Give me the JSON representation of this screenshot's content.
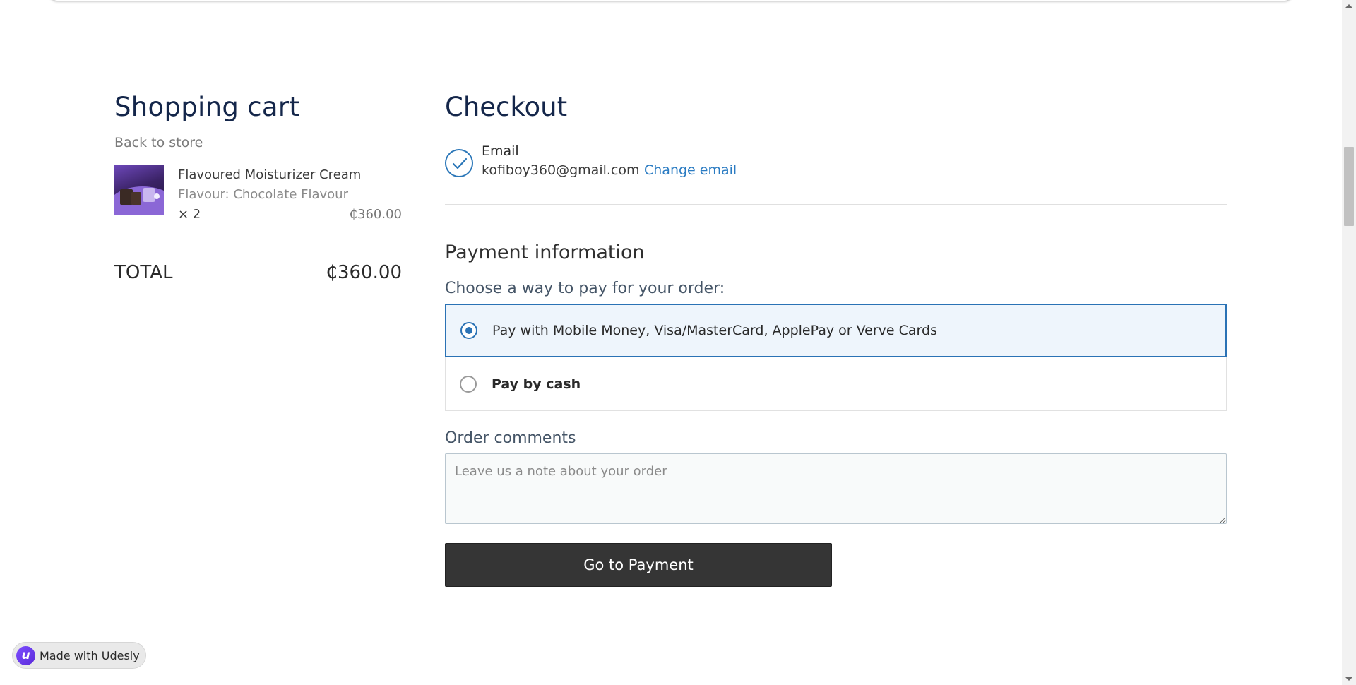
{
  "cart": {
    "title": "Shopping cart",
    "back_link": "Back to store",
    "items": [
      {
        "name": "Flavoured Moisturizer Cream",
        "variant": "Flavour: Chocolate Flavour",
        "quantity": "× 2",
        "price": "₵360.00",
        "image_icon": "product-photo-icon"
      }
    ],
    "total_label": "TOTAL",
    "total_value": "₵360.00"
  },
  "checkout": {
    "title": "Checkout",
    "email": {
      "label": "Email",
      "value": "kofiboy360@gmail.com",
      "change_link": "Change email",
      "status_icon": "checkmark-circle-icon"
    },
    "payment": {
      "heading": "Payment information",
      "prompt": "Choose a way to pay for your order:",
      "options": [
        {
          "label": "Pay with Mobile Money, Visa/MasterCard, ApplePay or Verve Cards",
          "selected": true
        },
        {
          "label": "Pay by cash",
          "selected": false
        }
      ]
    },
    "comments": {
      "label": "Order comments",
      "placeholder": "Leave us a note about your order",
      "value": ""
    },
    "submit_label": "Go to Payment"
  },
  "badge": {
    "text": "Made with Udesly",
    "logo_letter": "u"
  },
  "colors": {
    "heading": "#14264a",
    "accent": "#2a72b5",
    "link": "#2a7bc2",
    "button": "#353535",
    "selected_bg": "#eef5fc"
  }
}
